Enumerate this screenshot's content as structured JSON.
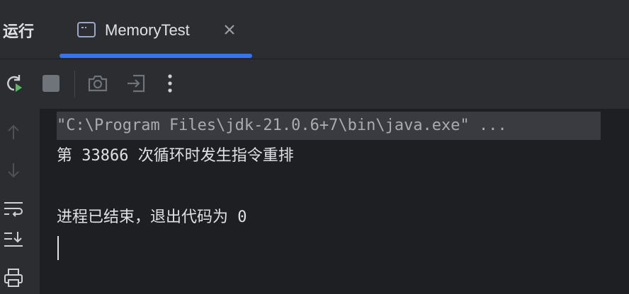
{
  "panel": {
    "title": "运行"
  },
  "tab": {
    "label": "MemoryTest",
    "icon": "console-window-icon",
    "close_icon": "close-icon"
  },
  "toolbar": {
    "rerun": "rerun-icon",
    "stop": "stop-icon",
    "screenshot": "camera-icon",
    "exit": "exit-icon",
    "more": "more-vertical-icon"
  },
  "gutter": {
    "up": "arrow-up-icon",
    "down": "arrow-down-icon",
    "soft_wrap": "soft-wrap-icon",
    "scroll_end": "scroll-to-end-icon",
    "print": "print-icon"
  },
  "console": {
    "command": "\"C:\\Program Files\\jdk-21.0.6+7\\bin\\java.exe\" ...",
    "line1": "第 33866 次循环时发生指令重排",
    "line2": "进程已结束，退出代码为 0"
  },
  "colors": {
    "background": "#1e1f22",
    "panel": "#2b2d30",
    "accent": "#3574f0",
    "command_highlight": "#393b40"
  }
}
